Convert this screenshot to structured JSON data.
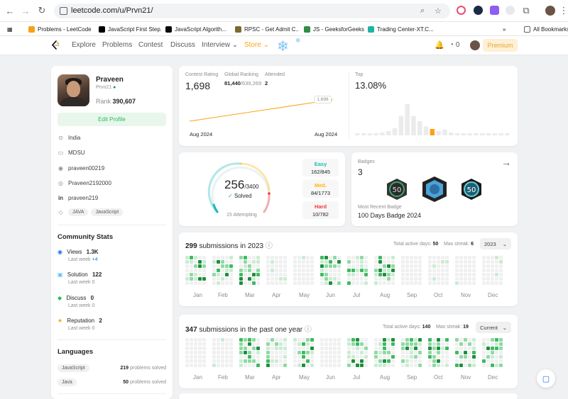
{
  "browser": {
    "url": "leetcode.com/u/Prvn21/",
    "bookmarks": [
      {
        "label": "Problems - LeetCode",
        "color": "#f89f1b"
      },
      {
        "label": "JavaScript First Step...",
        "color": "#000000"
      },
      {
        "label": "JavaScript Algorith...",
        "color": "#0a0a0a"
      },
      {
        "label": "RPSC - Get Admit C...",
        "color": "#7b6a2d"
      },
      {
        "label": "JS - GeeksforGeeks",
        "color": "#2f8d46"
      },
      {
        "label": "Trading Center-XT.C...",
        "color": "#1db4a5"
      }
    ],
    "bookmarks_more": "»",
    "all_bookmarks": "All Bookmarks"
  },
  "nav": {
    "items": [
      "Explore",
      "Problems",
      "Contest",
      "Discuss",
      "Interview",
      "Store"
    ],
    "streak_count": "0",
    "premium": "Premium"
  },
  "profile": {
    "name": "Praveen",
    "username": "Prvn21",
    "rank_label": "Rank",
    "rank": "390,607",
    "edit": "Edit Profile",
    "location": "India",
    "school": "MDSU",
    "github": "praveen00219",
    "link": "Praveen2192000",
    "linkedin": "praveen219",
    "skills": [
      "JAVA",
      "JavaScript"
    ]
  },
  "community": {
    "title": "Community Stats",
    "stats": [
      {
        "label": "Views",
        "value": "1.3K",
        "week": "Last week",
        "delta": "+4",
        "icon": "eye-icon",
        "color": "#1a73e8"
      },
      {
        "label": "Solution",
        "value": "122",
        "week": "Last week",
        "delta": "0",
        "icon": "solution-icon",
        "color": "#62c0f5"
      },
      {
        "label": "Discuss",
        "value": "0",
        "week": "Last week",
        "delta": "0",
        "icon": "discuss-icon",
        "color": "#2cbb5d"
      },
      {
        "label": "Reputation",
        "value": "2",
        "week": "Last week",
        "delta": "0",
        "icon": "star-icon",
        "color": "#ffa116"
      }
    ]
  },
  "languages": {
    "title": "Languages",
    "items": [
      {
        "name": "JavaScript",
        "count": "219",
        "suffix": "problems solved"
      },
      {
        "name": "Java",
        "count": "50",
        "suffix": "problems solved"
      }
    ]
  },
  "contest": {
    "rating_label": "Contest Rating",
    "rating": "1,698",
    "global_label": "Global Ranking",
    "global_rank": "81,440",
    "global_total": "/639,269",
    "attended_label": "Attended",
    "attended": "2",
    "tooltip": "1,698",
    "x_start": "Aug 2024",
    "x_end": "Aug 2024",
    "top_label": "Top",
    "top_value": "13.08%",
    "histogram": [
      0.05,
      0.05,
      0.05,
      0.06,
      0.08,
      0.12,
      0.2,
      0.55,
      0.88,
      0.55,
      0.4,
      0.25,
      0.18,
      0.12,
      0.16,
      0.08,
      0.05,
      0.05,
      0.05,
      0.05,
      0.05,
      0.05,
      0.05,
      0.05,
      0.05
    ],
    "highlight_index": 12,
    "highlight_color": "#ffa116"
  },
  "solved": {
    "count": "256",
    "total": "/3400",
    "label": "Solved",
    "attempting": "15 Attempting",
    "easy": {
      "label": "Easy",
      "value": "162/845",
      "color": "#1cbaba"
    },
    "medium": {
      "label": "Med.",
      "value": "84/1773",
      "color": "#ffb700"
    },
    "hard": {
      "label": "Hard",
      "value": "10/782",
      "color": "#f63737"
    }
  },
  "badges": {
    "label": "Badges",
    "count": "3",
    "recent_label": "Most Recent Badge",
    "recent": "100 Days Badge 2024",
    "items": [
      "badge-50-days-icon",
      "badge-100-days-icon",
      "badge-50-days-2024-icon"
    ]
  },
  "sub2023": {
    "count": "299",
    "text": "submissions in 2023",
    "active_label": "Total active days:",
    "active": "50",
    "streak_label": "Max streak:",
    "streak": "6",
    "dropdown": "2023",
    "months": [
      "Jan",
      "Feb",
      "Mar",
      "Apr",
      "May",
      "Jun",
      "Jul",
      "Aug",
      "Sep",
      "Oct",
      "Nov",
      "Dec"
    ]
  },
  "subyear": {
    "count": "347",
    "text": "submissions in the past one year",
    "active_label": "Total active days:",
    "active": "140",
    "streak_label": "Max streak:",
    "streak": "19",
    "dropdown": "Current",
    "months": [
      "Jan",
      "Feb",
      "Mar",
      "Apr",
      "May",
      "Jun",
      "Jul",
      "Aug",
      "Sep",
      "Oct",
      "Nov",
      "Dec"
    ]
  }
}
